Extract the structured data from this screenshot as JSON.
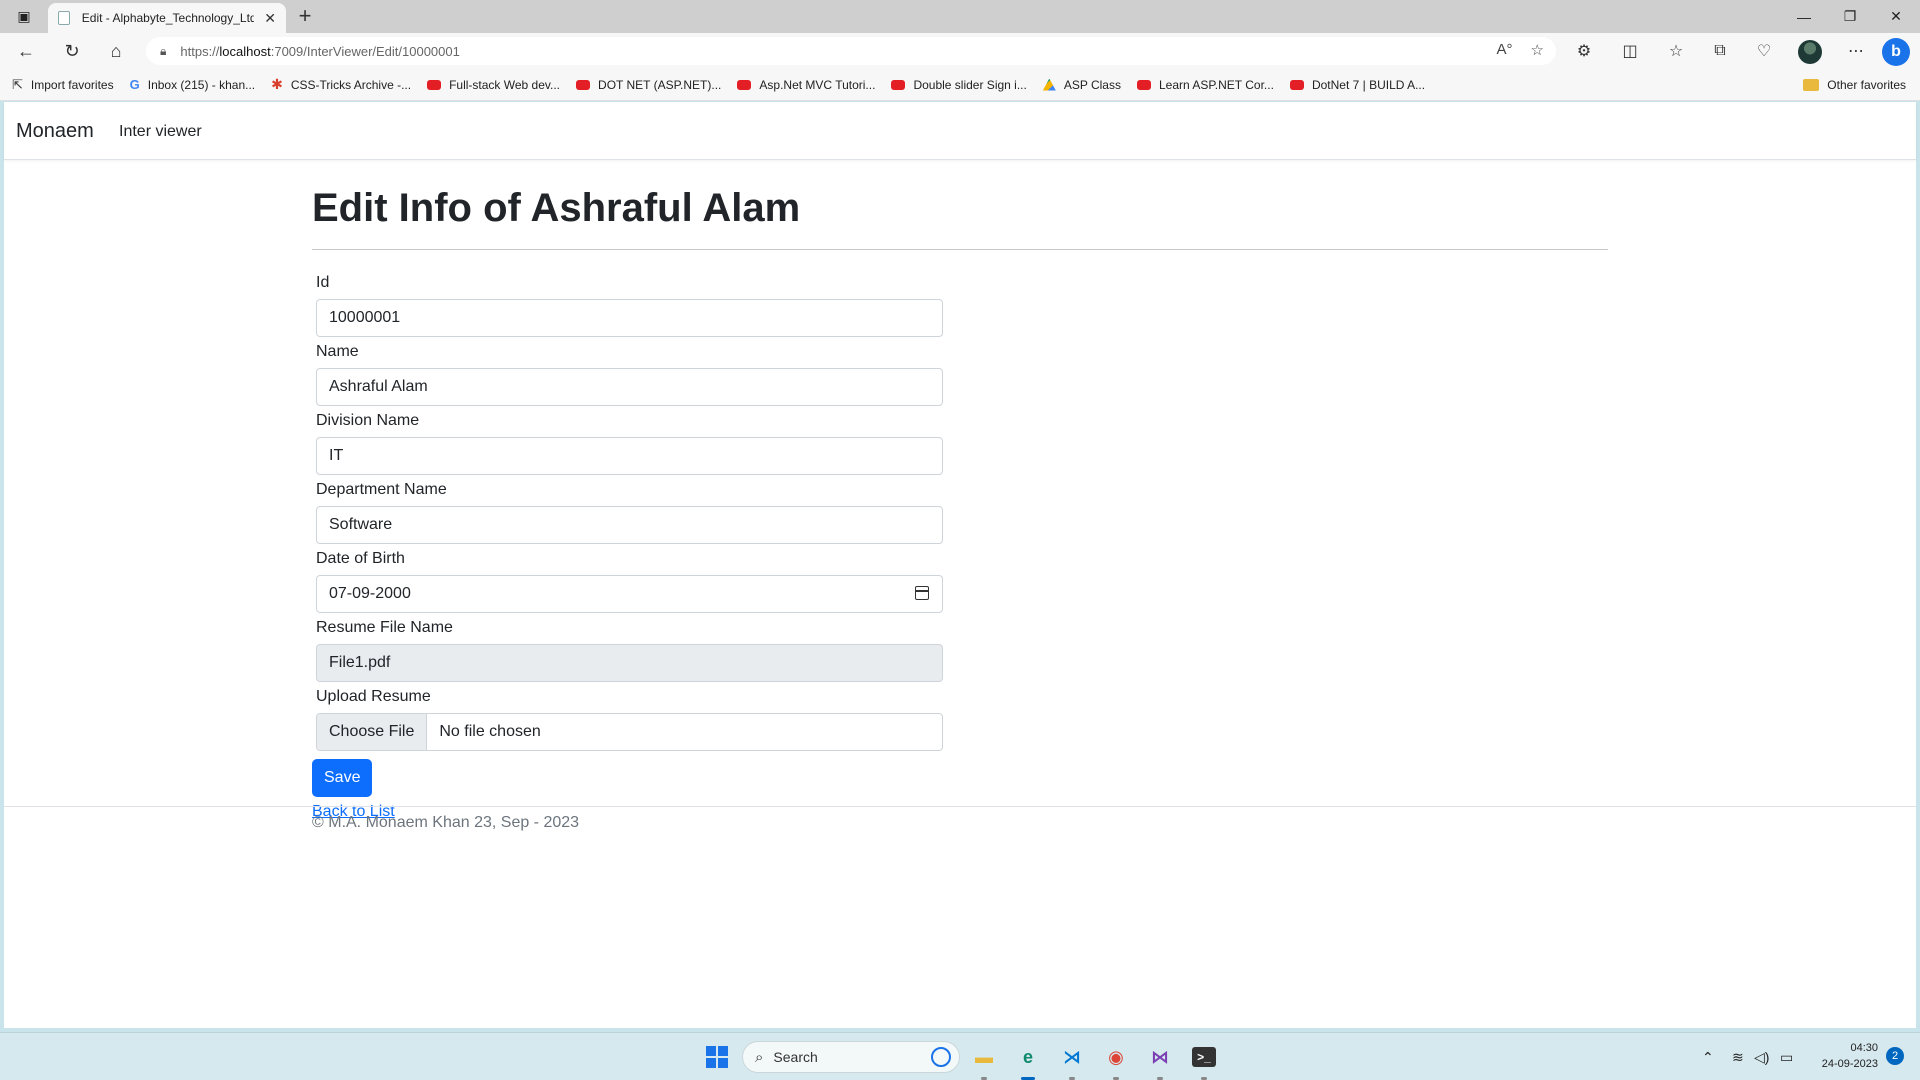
{
  "browser": {
    "tab_title": "Edit - Alphabyte_Technology_Ltd",
    "url_prefix": "https://",
    "url_host": "localhost",
    "url_path": ":7009/InterViewer/Edit/10000001",
    "favorites": [
      {
        "label": "Import favorites",
        "icon": "import-icon"
      },
      {
        "label": "Inbox (215) - khan...",
        "icon": "google-icon"
      },
      {
        "label": "CSS-Tricks Archive -...",
        "icon": "css-tricks-icon"
      },
      {
        "label": "Full-stack Web dev...",
        "icon": "youtube-icon"
      },
      {
        "label": "DOT NET (ASP.NET)...",
        "icon": "youtube-icon"
      },
      {
        "label": "Asp.Net MVC Tutori...",
        "icon": "youtube-icon"
      },
      {
        "label": "Double slider Sign i...",
        "icon": "youtube-icon"
      },
      {
        "label": "ASP Class",
        "icon": "google-drive-icon"
      },
      {
        "label": "Learn ASP.NET Cor...",
        "icon": "youtube-icon"
      },
      {
        "label": "DotNet 7 | BUILD A...",
        "icon": "youtube-icon"
      }
    ],
    "other_favorites": "Other favorites"
  },
  "site": {
    "brand": "Monaem",
    "nav_link": "Inter viewer"
  },
  "page": {
    "heading": "Edit Info of Ashraful Alam",
    "fields": {
      "id": {
        "label": "Id",
        "value": "10000001"
      },
      "name": {
        "label": "Name",
        "value": "Ashraful Alam"
      },
      "division": {
        "label": "Division Name",
        "value": "IT"
      },
      "department": {
        "label": "Department Name",
        "value": "Software"
      },
      "dob": {
        "label": "Date of Birth",
        "value": "07-09-2000"
      },
      "resume_file": {
        "label": "Resume File Name",
        "value": "File1.pdf"
      },
      "upload": {
        "label": "Upload Resume",
        "button": "Choose File",
        "status": "No file chosen"
      }
    },
    "save_label": "Save",
    "back_label": "Back to List",
    "footer": "© M.A. Monaem Khan 23, Sep - 2023"
  },
  "taskbar": {
    "search_placeholder": "Search",
    "time": "04:30",
    "date": "24-09-2023",
    "notifications": "2"
  },
  "colors": {
    "primary": "#0d6efd",
    "taskbar": "#d6e9ee"
  }
}
